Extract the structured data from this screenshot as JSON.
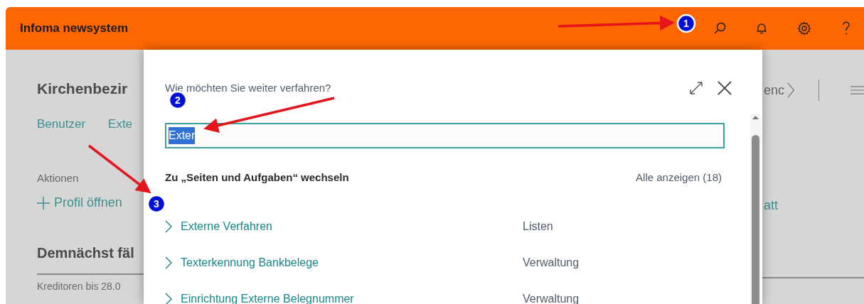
{
  "app": {
    "title": "Infoma newsystem"
  },
  "background_page": {
    "title": "Kirchenbezir",
    "links": [
      "Benutzer",
      "Exte"
    ],
    "actions_label": "Aktionen",
    "action": "Profil öffnen",
    "section_title": "Demnächst fäl",
    "section_item": "Kreditoren bis 28.0",
    "right_title": "enc",
    "right_action": "att"
  },
  "dialog": {
    "prompt": "Wie möchten Sie weiter verfahren?",
    "search": {
      "value": "Exter",
      "value_selected": true
    },
    "group": {
      "title": "Zu „Seiten und Aufgaben“ wechseln",
      "show_all": "Alle anzeigen (18)",
      "results": [
        {
          "name": "Externe Verfahren",
          "category": "Listen"
        },
        {
          "name": "Texterkennung Bankbelege",
          "category": "Verwaltung"
        },
        {
          "name": "Einrichtung Externe Belegnummer",
          "category": "Verwaltung"
        }
      ]
    }
  },
  "annotations": [
    {
      "number": "1"
    },
    {
      "number": "2"
    },
    {
      "number": "3"
    }
  ]
}
